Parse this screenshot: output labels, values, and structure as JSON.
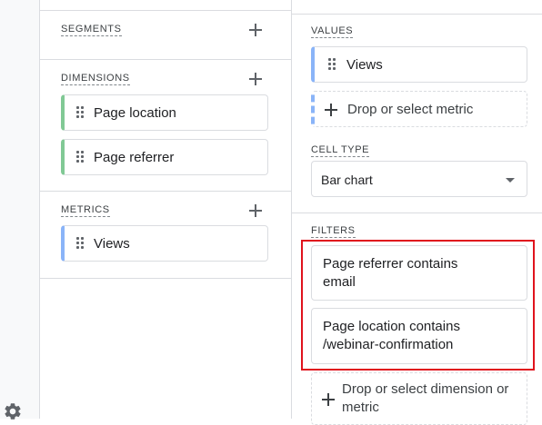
{
  "variables": {
    "segments": {
      "label": "SEGMENTS"
    },
    "dimensions": {
      "label": "DIMENSIONS",
      "items": [
        {
          "label": "Page location"
        },
        {
          "label": "Page referrer"
        }
      ]
    },
    "metrics": {
      "label": "METRICS",
      "items": [
        {
          "label": "Views"
        }
      ]
    }
  },
  "settings": {
    "values": {
      "label": "VALUES",
      "items": [
        {
          "label": "Views"
        }
      ],
      "drop_label": "Drop or select metric"
    },
    "cell_type": {
      "label": "CELL TYPE",
      "selected": "Bar chart"
    },
    "filters": {
      "label": "FILTERS",
      "items": [
        {
          "line1": "Page referrer contains",
          "line2": "email"
        },
        {
          "line1": "Page location contains",
          "line2": "/webinar-confirmation"
        }
      ],
      "drop_line1": "Drop or select dimension or",
      "drop_line2": "metric"
    }
  },
  "colors": {
    "dimension_accent": "#81c995",
    "metric_accent": "#8ab4f8",
    "highlight": "#e0131d"
  },
  "icons": {
    "settings": "gear-icon",
    "add": "plus-icon",
    "drag": "drag-handle-icon",
    "dropdown": "caret-down-icon"
  }
}
